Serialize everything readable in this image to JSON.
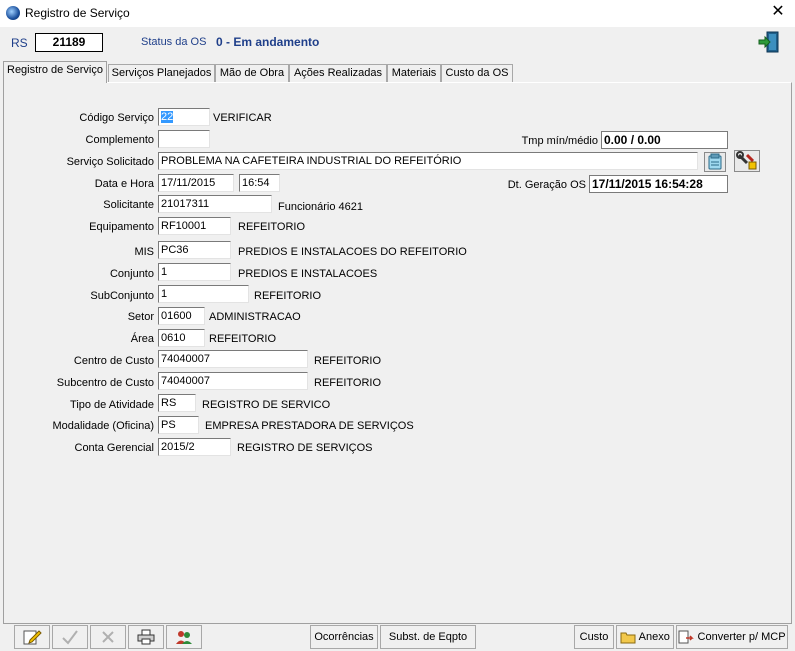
{
  "window": {
    "title": "Registro de Serviço",
    "close_glyph": "✕"
  },
  "header": {
    "rs_label": "RS",
    "rs_number": "21189",
    "status_label": "Status da OS",
    "status_value": "0 - Em andamento"
  },
  "tabs": [
    {
      "label": "Registro de Serviço",
      "active": true
    },
    {
      "label": "Serviços Planejados"
    },
    {
      "label": "Mão de Obra"
    },
    {
      "label": "Ações Realizadas"
    },
    {
      "label": "Materiais"
    },
    {
      "label": "Custo da OS"
    }
  ],
  "form": {
    "codigo": {
      "label": "Código Serviço",
      "value": "22",
      "desc": "VERIFICAR"
    },
    "complemento": {
      "label": "Complemento",
      "value": ""
    },
    "tmp": {
      "label": "Tmp mín/médio",
      "value": "0.00 / 0.00"
    },
    "servico": {
      "label": "Serviço Solicitado",
      "value": "PROBLEMA NA CAFETEIRA INDUSTRIAL DO REFEITÓRIO"
    },
    "data_hora": {
      "label": "Data e Hora",
      "date": "17/11/2015",
      "time": "16:54"
    },
    "dt_geracao": {
      "label": "Dt. Geração OS",
      "value": "17/11/2015 16:54:28"
    },
    "solicitante": {
      "label": "Solicitante",
      "value": "21017311",
      "desc": "Funcionário 4621"
    },
    "equipamento": {
      "label": "Equipamento",
      "value": "RF10001",
      "desc": "REFEITORIO"
    },
    "mis": {
      "label": "MIS",
      "value": "PC36",
      "desc": "PREDIOS E INSTALACOES DO REFEITORIO"
    },
    "conjunto": {
      "label": "Conjunto",
      "value": "1",
      "desc": "PREDIOS E INSTALACOES"
    },
    "subconjunto": {
      "label": "SubConjunto",
      "value": "1",
      "desc": "REFEITORIO"
    },
    "setor": {
      "label": "Setor",
      "value": "01600",
      "desc": "ADMINISTRACAO"
    },
    "area": {
      "label": "Área",
      "value": "0610",
      "desc": "REFEITORIO"
    },
    "centro_custo": {
      "label": "Centro de Custo",
      "value": "74040007",
      "desc": "REFEITORIO"
    },
    "subcentro": {
      "label": "Subcentro de Custo",
      "value": "74040007",
      "desc": "REFEITORIO"
    },
    "tipo_atividade": {
      "label": "Tipo de Atividade",
      "value": "RS",
      "desc": "REGISTRO DE SERVICO"
    },
    "modalidade": {
      "label": "Modalidade (Oficina)",
      "value": "PS",
      "desc": "EMPRESA PRESTADORA DE SERVIÇOS"
    },
    "conta": {
      "label": "Conta Gerencial",
      "value": "2015/2",
      "desc": "REGISTRO DE SERVIÇOS"
    }
  },
  "toolbar": {
    "ocorrencias": "Ocorrências",
    "subst": "Subst. de Eqpto",
    "custo": "Custo",
    "anexo": "Anexo",
    "converter": "Converter p/ MCP"
  }
}
